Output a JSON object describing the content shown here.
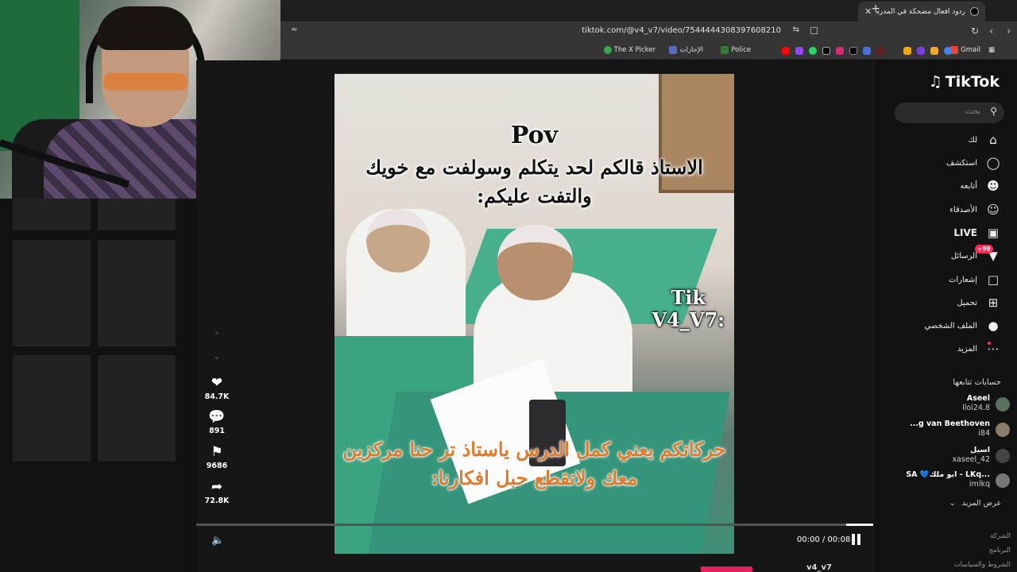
{
  "browser": {
    "tab_title": "ردود أفعال مضحكة في المدرسة",
    "tab_close": "✕",
    "new_tab": "+",
    "url": "tiktok.com/@v4_v7/video/7544444308397608210"
  },
  "bookmarks": [
    {
      "label": "Gmail"
    },
    {
      "label": "Police"
    },
    {
      "label": "الإجازات"
    },
    {
      "label": "The X Picker"
    }
  ],
  "video": {
    "pov": "Pov",
    "top_text": "الاستاذ قالكم لحد يتكلم وسولفت مع خويك والتفت عليكم:",
    "watermark_1": "Tik",
    "watermark_2": "V4_V7:",
    "bottom_text": "حركاتكم يعني كمل الدرس ياستاذ تر حنا مركزين معك ولاتقطع حبل افكارنا:",
    "progress": 0.0,
    "time": "00:00 / 00:08",
    "author_handle": "v4_v7"
  },
  "actions": {
    "likes": "84.7K",
    "comments": "891",
    "saves": "9686",
    "shares": "72.8K"
  },
  "sidebar": {
    "logo": "TikTok",
    "search_placeholder": "بحث",
    "nav": [
      {
        "label": "لك",
        "icon": "home-icon"
      },
      {
        "label": "استكشف",
        "icon": "compass-icon"
      },
      {
        "label": "أتابعه",
        "icon": "user-plus-icon"
      },
      {
        "label": "الأصدقاء",
        "icon": "friends-icon"
      },
      {
        "label": "LIVE",
        "icon": "live-icon"
      },
      {
        "label": "الرسائل",
        "icon": "inbox-icon",
        "badge": "+99"
      },
      {
        "label": "إشعارات",
        "icon": "message-icon"
      },
      {
        "label": "تحميل",
        "icon": "upload-icon"
      },
      {
        "label": "الملف الشخصي",
        "icon": "avatar-icon"
      },
      {
        "label": "المزيد",
        "icon": "more-icon"
      }
    ],
    "following_header": "حسابات تتابعها",
    "following": [
      {
        "name": "Aseel",
        "handle": "lloi24.8"
      },
      {
        "name": "...g van Beethoven",
        "handle": "i84"
      },
      {
        "name": "اسيل",
        "handle": "xaseel_42"
      },
      {
        "name": "SA 💙ابو ملك - LKq...",
        "handle": "imlkq"
      }
    ],
    "see_more": "عرض المزيد",
    "footer": [
      "الشركة",
      "البرنامج",
      "الشروط والسياسات"
    ]
  }
}
